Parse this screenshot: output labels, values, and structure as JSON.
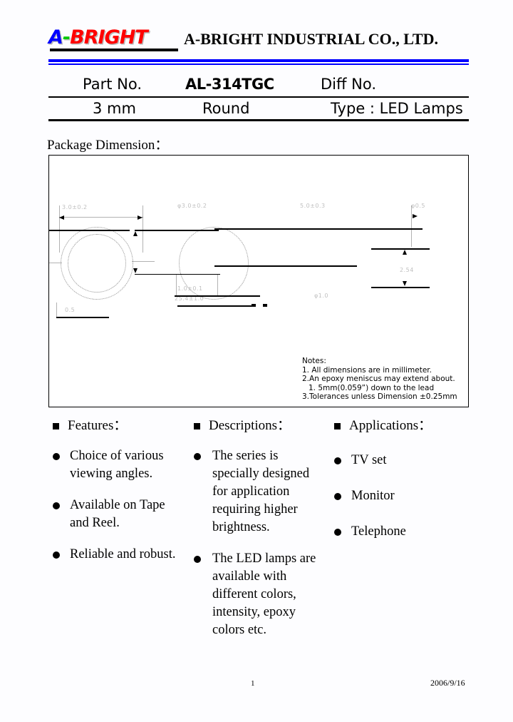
{
  "header": {
    "logo": {
      "a": "A",
      "dash": "-",
      "bright": "BRIGHT"
    },
    "company_name": "A-BRIGHT INDUSTRIAL CO., LTD.",
    "rule_color": "#0000ff",
    "logo_colors": {
      "a": "#0000ff",
      "dash": "#00c800",
      "bright": "#ff0000"
    }
  },
  "part_table": {
    "row1": {
      "label_part_no": "Part No.",
      "part_no": "AL-314TGC",
      "label_diff_no": "Diff No."
    },
    "row2": {
      "size": "3 mm",
      "shape": "Round",
      "type": "Type : LED Lamps"
    }
  },
  "package": {
    "title": "Package Dimension：",
    "dimensions": {
      "d1": "3.0±0.2",
      "d2": "φ3.0±0.2",
      "d3": "5.0±0.3",
      "d4": "φ0.5",
      "d5": "1.0±0.1",
      "d6": "25.4±1.0",
      "d7": "2.54",
      "d8": "0.5",
      "d9": "φ1.0"
    },
    "notes": {
      "title": "Notes:",
      "line1": "1. All dimensions are in millimeter.",
      "line2": "2.An epoxy meniscus may extend about.",
      "line3": "1. 5mm(0.059”) down to the lead",
      "line4": "3.Tolerances unless Dimension ±0.25mm"
    }
  },
  "columns": {
    "features": {
      "heading": "Features：",
      "items": [
        "Choice of various viewing angles.",
        "Available on Tape and Reel.",
        "Reliable and robust."
      ]
    },
    "descriptions": {
      "heading": "Descriptions：",
      "items": [
        "The series is specially designed for application requiring higher brightness.",
        "The LED lamps are available with different colors, intensity, epoxy colors etc."
      ]
    },
    "applications": {
      "heading": "Applications：",
      "items": [
        "TV set",
        "Monitor",
        "Telephone"
      ]
    }
  },
  "footer": {
    "page_number": "1",
    "date": "2006/9/16"
  }
}
